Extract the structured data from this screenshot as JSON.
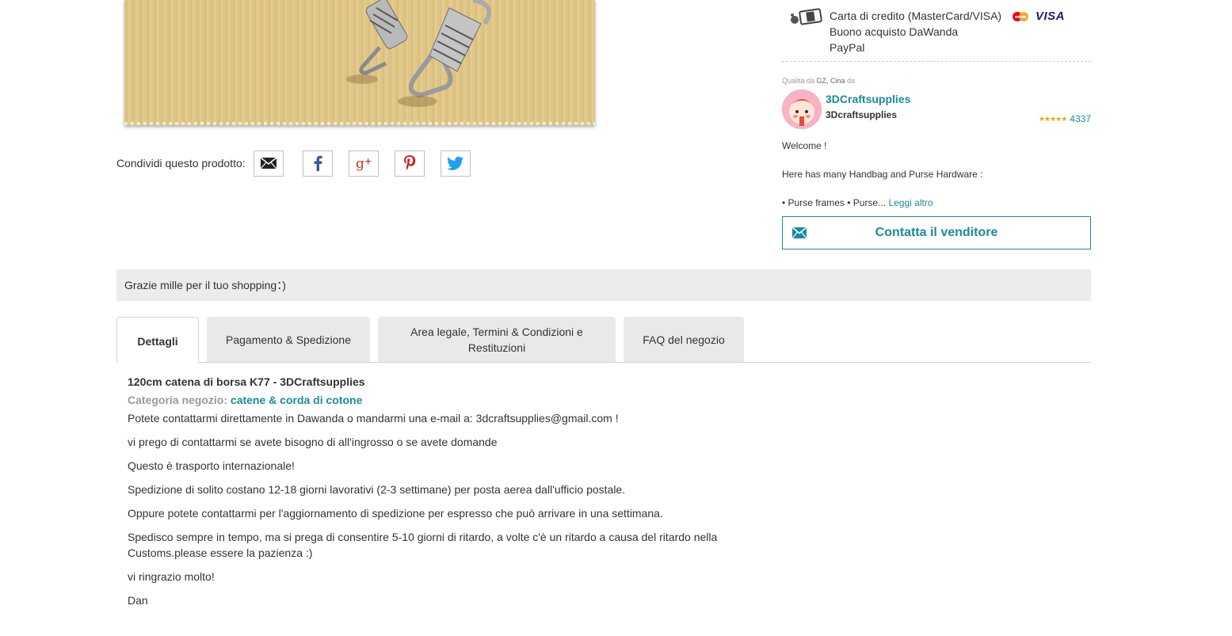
{
  "payment": {
    "methods": [
      "Carta di credito (MasterCard/VISA)",
      "Buono acquisto DaWanda",
      "PayPal"
    ],
    "visa_label": "VISA",
    "icons": [
      "payment-icon",
      "mastercard-icon"
    ]
  },
  "share": {
    "label": "Condividi questo prodotto:",
    "buttons": [
      "email-icon",
      "facebook-icon",
      "google-plus-icon",
      "pinterest-icon",
      "twitter-icon"
    ]
  },
  "seller": {
    "origin_prefix": "Qualità da",
    "origin_place": "GZ, Cina",
    "origin_suffix": "da",
    "shop_name": "3DCraftsupplies",
    "username": "3Dcraftsupplies",
    "rating_stars": 5,
    "rating_count": "4337",
    "description": [
      "Welcome !",
      "Here has many Handbag and Purse Hardware :",
      "• Purse frames • Purse..."
    ],
    "read_more": "Leggi altro",
    "contact_label": "Contatta il venditore"
  },
  "thanks_message": "Grazie mille per il tuo shopping：)",
  "tabs": [
    {
      "label": "Dettagli",
      "active": true
    },
    {
      "label": "Pagamento & Spedizione",
      "active": false
    },
    {
      "label": "Area legale, Termini & Condizioni e Restituzioni",
      "active": false
    },
    {
      "label": "FAQ del negozio",
      "active": false
    }
  ],
  "details": {
    "title": "120cm catena di borsa K77 - 3DCraftsupplies",
    "category_label": "Categoria negozio:",
    "category_value": "catene & corda di cotone",
    "paragraphs": [
      "Potete contattarmi direttamente in Dawanda o mandarmi una e-mail a: 3dcraftsupplies@gmail.com !",
      "vi prego di contattarmi se avete bisogno di all'ingrosso o se avete domande",
      "Questo è trasporto internazionale!",
      "Spedizione di solito costano 12-18 giorni lavorativi (2-3 settimane) per posta aerea dall'ufficio postale.",
      "Oppure potete contattarmi per l'aggiornamento di spedizione per espresso che può arrivare in una settimana.",
      "Spedisco sempre in tempo, ma si prega di consentire 5-10 giorni di ritardo, a volte c'è un ritardo a causa del ritardo nella Customs.please essere la pazienza :)",
      "vi ringrazio molto!",
      "Dan"
    ]
  },
  "colors": {
    "accent": "#1a8a9c",
    "banner_bg": "#ececec",
    "tab_bg": "#e9e9e9",
    "star": "#f0a500"
  }
}
